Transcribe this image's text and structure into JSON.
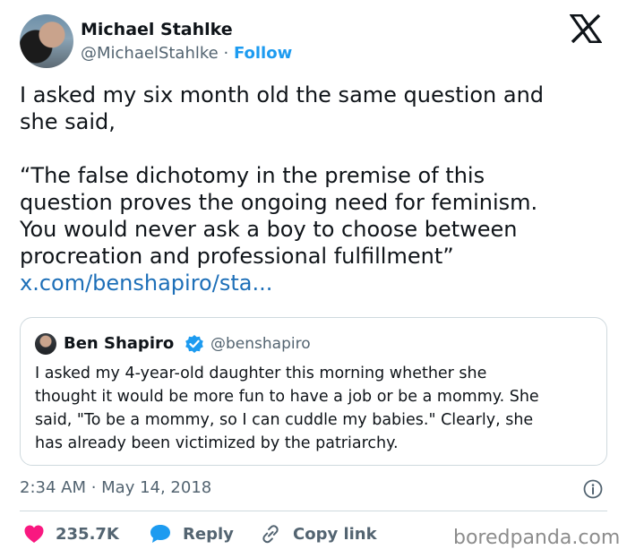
{
  "author": {
    "name": "Michael Stahlke",
    "handle": "@MichaelStahlke",
    "separator": "·",
    "follow_label": "Follow"
  },
  "tweet": {
    "lines": [
      "I asked my six month old the same question and",
      "she said,",
      "",
      "“The false dichotomy in the premise of this",
      "question proves the ongoing need for feminism.",
      "You would never ask a boy to choose between",
      "procreation and professional fulfillment”"
    ],
    "link": "x.com/benshapiro/sta..."
  },
  "quote": {
    "name": "Ben Shapiro",
    "handle": "@benshapiro",
    "lines": [
      "I asked my 4-year-old daughter this morning whether she",
      "thought it would be more fun to have a job or be a mommy. She",
      "said, \"To be a mommy, so I can cuddle my babies.\" Clearly, she",
      "has already been victimized by the patriarchy."
    ]
  },
  "timestamp": "2:34 AM · May 14, 2018",
  "actions": {
    "like_count": "235.7K",
    "reply_label": "Reply",
    "copy_label": "Copy link"
  },
  "watermark": "boredpanda.com",
  "colors": {
    "accent": "#1d9bf0",
    "like": "#f91880",
    "text": "#0f1419",
    "muted": "#536471",
    "border": "#cfd9de"
  },
  "icons": [
    "x-logo-icon",
    "verified-badge-icon",
    "info-icon",
    "heart-icon",
    "reply-bubble-icon",
    "link-icon"
  ]
}
